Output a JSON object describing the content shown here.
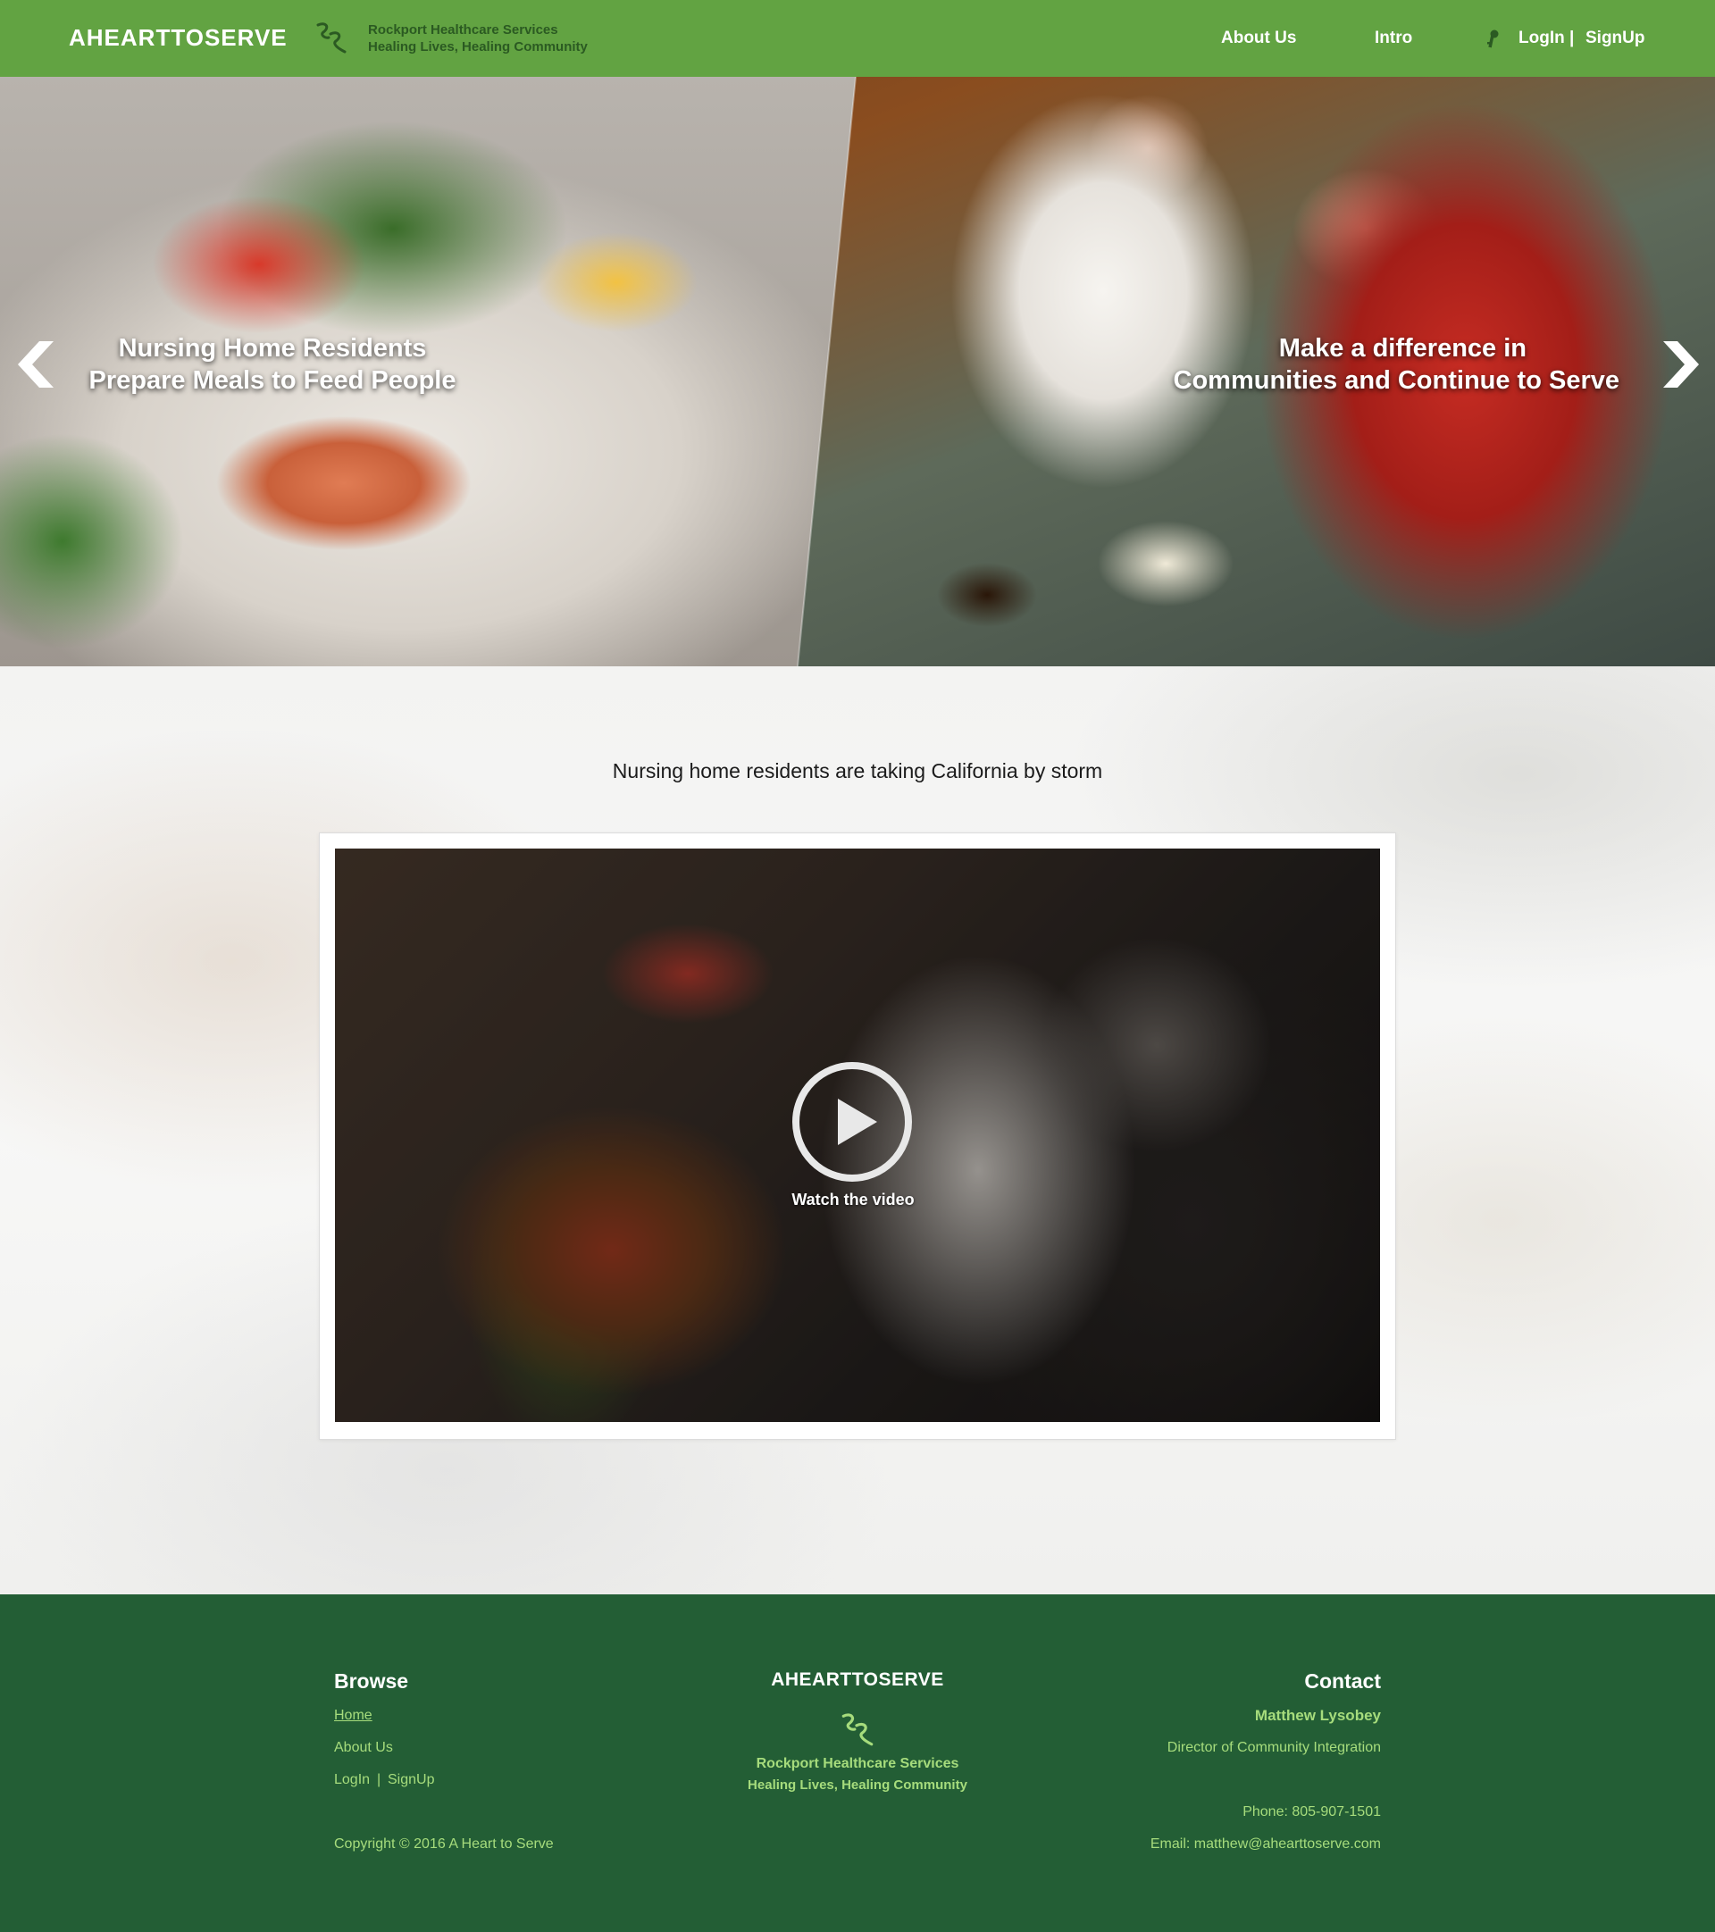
{
  "header": {
    "brand": "AHEARTTOSERVE",
    "org_name": "Rockport Healthcare Services",
    "org_tagline": "Healing Lives, Healing Community",
    "nav": {
      "about": "About Us",
      "intro": "Intro",
      "login": "LogIn",
      "separator": "|",
      "signup": "SignUp"
    },
    "icons": {
      "logo": "rr-swirl-logo-icon",
      "login": "key-icon"
    }
  },
  "hero": {
    "left_caption": [
      "Nursing Home Residents",
      "Prepare Meals to Feed People"
    ],
    "right_caption": [
      "Make a difference in",
      "Communities and Continue to Serve"
    ],
    "icons": {
      "prev": "chevron-left-icon",
      "next": "chevron-right-icon"
    }
  },
  "main": {
    "tagline": "Nursing home residents are taking California by storm",
    "video": {
      "label": "Watch the video",
      "icon": "play-circle-icon"
    }
  },
  "footer": {
    "browse": {
      "heading": "Browse",
      "home": "Home",
      "about": "About Us",
      "login": "LogIn",
      "separator": "|",
      "signup": "SignUp"
    },
    "copyright": "Copyright © 2016 A Heart to Serve",
    "center": {
      "brand": "AHEARTTOSERVE",
      "org_name": "Rockport Healthcare Services",
      "org_tagline": "Healing Lives, Healing Community"
    },
    "contact": {
      "heading": "Contact",
      "name": "Matthew Lysobey",
      "role": "Director of Community Integration",
      "phone": "Phone: 805-907-1501",
      "email": "Email: matthew@ahearttoserve.com"
    }
  },
  "colors": {
    "header_green": "#62a342",
    "footer_green": "#235e35",
    "footer_text": "#a6dc7c",
    "org_text": "#2b5a22"
  }
}
